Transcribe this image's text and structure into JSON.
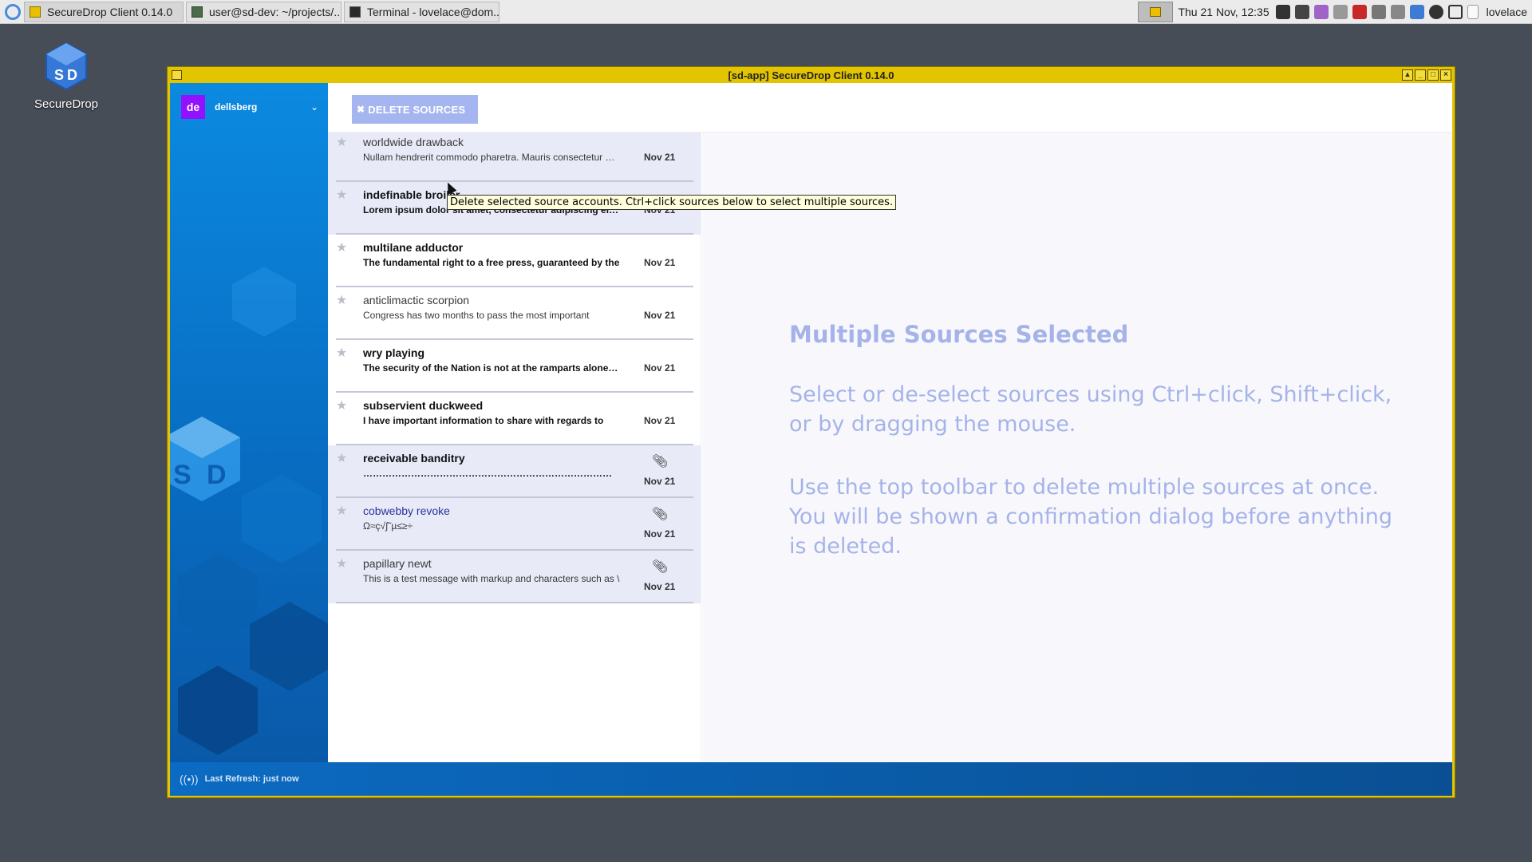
{
  "taskbar": {
    "tasks": [
      {
        "label": "SecureDrop Client 0.14.0"
      },
      {
        "label": "user@sd-dev: ~/projects/..."
      },
      {
        "label": "Terminal - lovelace@dom..."
      }
    ],
    "clock": "Thu 21 Nov, 12:35",
    "user": "lovelace"
  },
  "desktop": {
    "icon_label": "SecureDrop"
  },
  "window": {
    "title": "[sd-app] SecureDrop Client 0.14.0",
    "user": {
      "initials": "de",
      "name": "dellsberg"
    },
    "toolbar": {
      "delete_label": "DELETE SOURCES"
    },
    "tooltip": "Delete selected source accounts. Ctrl+click sources below to select multiple sources.",
    "sources": [
      {
        "name": "worldwide drawback",
        "preview": "Nullam hendrerit commodo pharetra. Mauris consectetur …",
        "date": "Nov 21"
      },
      {
        "name": "indefinable broiler",
        "preview": "Lorem ipsum dolor sit amet, consectetur adipiscing elit. …",
        "date": "Nov 21"
      },
      {
        "name": "multilane adductor",
        "preview": "The fundamental right to a free press, guaranteed by the",
        "date": "Nov 21"
      },
      {
        "name": "anticlimactic scorpion",
        "preview": "Congress has two months to pass the most important",
        "date": "Nov 21"
      },
      {
        "name": "wry playing",
        "preview": "The security of the Nation is not at the ramparts alone. S…",
        "date": "Nov 21"
      },
      {
        "name": "subservient duckweed",
        "preview": "I have important information to share with regards to",
        "date": "Nov 21"
      },
      {
        "name": "receivable banditry",
        "preview": "………………………………………………………………………………………………",
        "date": "Nov 21"
      },
      {
        "name": "cobwebby revoke",
        "preview": "Ω≈ç√∫˜µ≤≥÷",
        "date": "Nov 21"
      },
      {
        "name": "papillary newt",
        "preview": "This is a test message with markup and characters such as \\",
        "date": "Nov 21"
      }
    ],
    "detail": {
      "title": "Multiple Sources Selected",
      "p1": "Select or de-select sources using Ctrl+click, Shift+click, or by dragging the mouse.",
      "p2": "Use the top toolbar to delete multiple sources at once. You will be shown a confirmation dialog before anything is deleted."
    },
    "status": "Last Refresh: just now"
  }
}
